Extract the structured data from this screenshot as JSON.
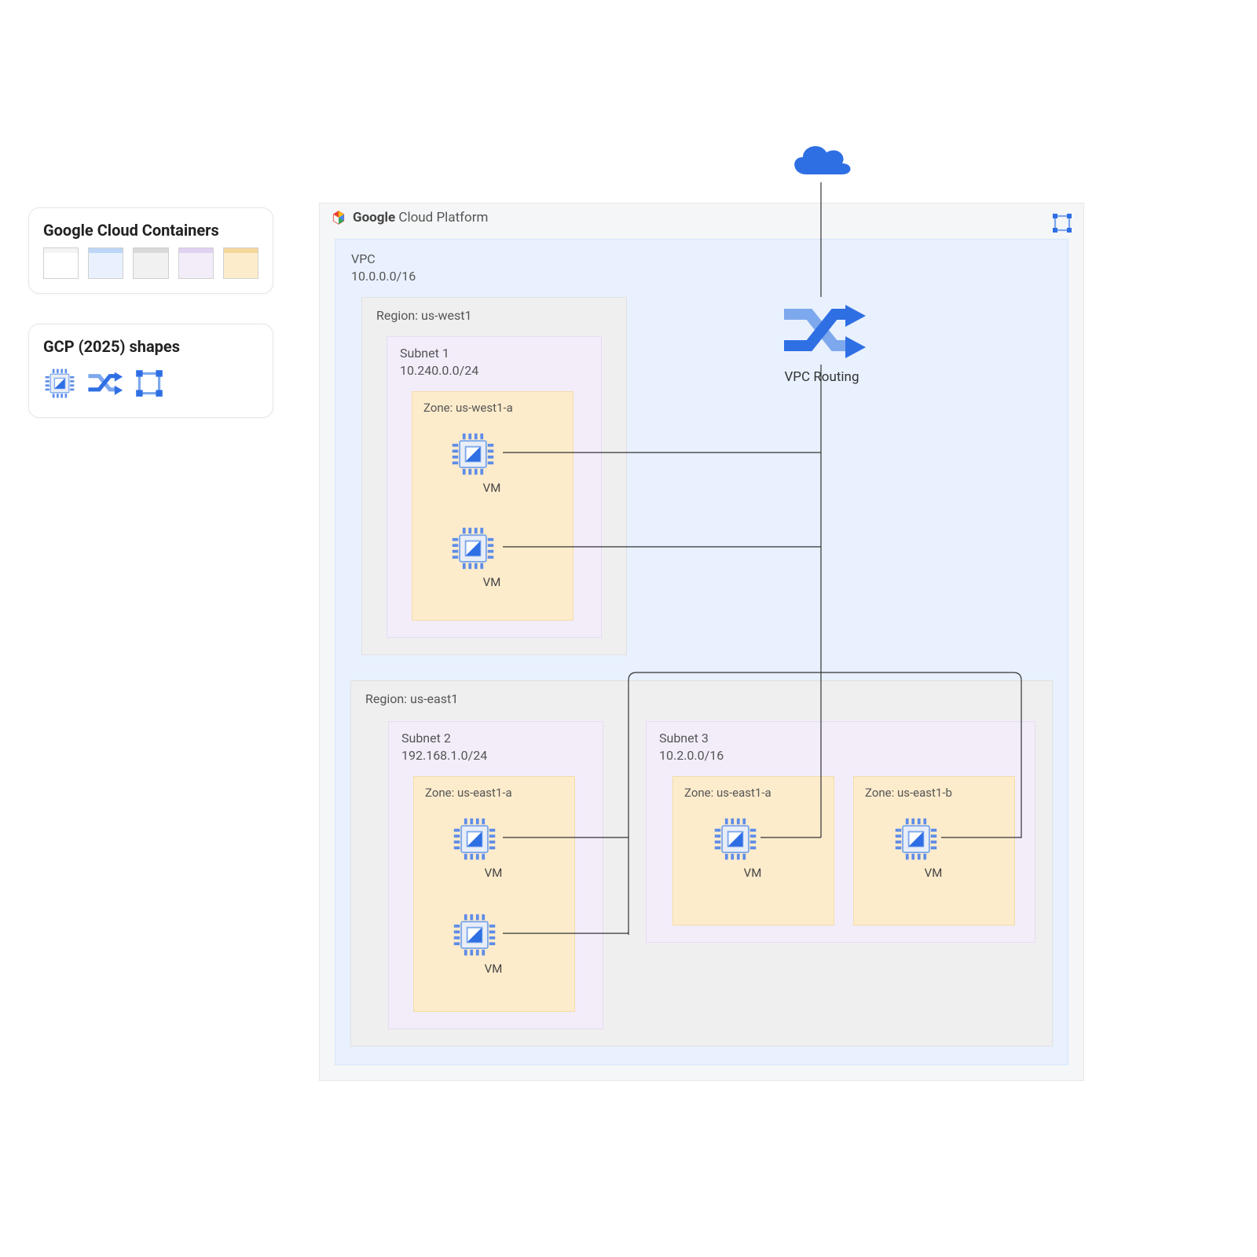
{
  "sidebar": {
    "containers_title": "Google Cloud Containers",
    "shapes_title": "GCP (2025) shapes",
    "swatch_colors": [
      {
        "bg": "#ffffff",
        "bar": "#f4f4f4"
      },
      {
        "bg": "#e8f1fd",
        "bar": "#bcd6f7"
      },
      {
        "bg": "#f1f1f1",
        "bar": "#d9d9d9"
      },
      {
        "bg": "#f3edfa",
        "bar": "#e0d1f1"
      },
      {
        "bg": "#fdeccc",
        "bar": "#f5d79a"
      }
    ]
  },
  "platform": {
    "title": "Google Cloud Platform"
  },
  "vpc": {
    "name": "VPC",
    "cidr": "10.0.0.0/16"
  },
  "routing": {
    "label": "VPC Routing"
  },
  "regions": {
    "west": {
      "label": "Region: us-west1",
      "subnet": {
        "name": "Subnet 1",
        "cidr": "10.240.0.0/24",
        "zone": {
          "label": "Zone: us-west1-a",
          "vm1": "VM",
          "vm2": "VM"
        }
      }
    },
    "east": {
      "label": "Region: us-east1",
      "subnet2": {
        "name": "Subnet 2",
        "cidr": "192.168.1.0/24",
        "zone": {
          "label": "Zone: us-east1-a",
          "vm1": "VM",
          "vm2": "VM"
        }
      },
      "subnet3": {
        "name": "Subnet 3",
        "cidr": "10.2.0.0/16",
        "zoneA": {
          "label": "Zone: us-east1-a",
          "vm": "VM"
        },
        "zoneB": {
          "label": "Zone: us-east1-b",
          "vm": "VM"
        }
      }
    }
  },
  "colors": {
    "blue": "#2f6fe4",
    "blue_light": "#7da8ed",
    "blue_mid": "#5e8ce8",
    "gray_line": "#333333"
  }
}
